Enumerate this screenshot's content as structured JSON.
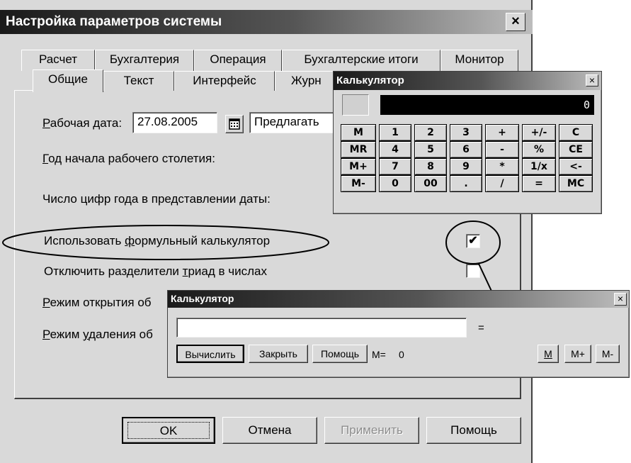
{
  "dialog": {
    "title": "Настройка параметров системы",
    "close": "×",
    "tabs_back": [
      "Расчет",
      "Бухгалтерия",
      "Операция",
      "Бухгалтерские итоги",
      "Монитор"
    ],
    "tabs_front": [
      "Общие",
      "Текст",
      "Интерфейс",
      "Журн"
    ],
    "work_date": {
      "label_u": "Р",
      "label_rest": "абочая дата:",
      "value": "27.08.2005",
      "combo_value": "Предлагать"
    },
    "century": {
      "label_u": "Г",
      "label_rest": "од начала рабочего столетия:"
    },
    "digits": {
      "label": "Число цифр года в представлении даты:"
    },
    "formula_calc": {
      "pre": "Использовать ",
      "u": "ф",
      "post": "ормульный калькулятор",
      "checked": "✔"
    },
    "triads": {
      "pre": "Отключить разделители ",
      "u": "т",
      "post": "риад в числах"
    },
    "open_mode": {
      "u": "Р",
      "rest": "ежим открытия об"
    },
    "delete_mode": {
      "u": "Р",
      "mid": "ежим ",
      "u2": "у",
      "rest": "даления об"
    },
    "buttons": {
      "ok": "OK",
      "cancel": "Отмена",
      "apply": "Применить",
      "help": "Помощь"
    }
  },
  "calculator": {
    "title": "Калькулятор",
    "close": "×",
    "display": "0",
    "keys": [
      [
        "M",
        "1",
        "2",
        "3",
        "+",
        "+/-",
        "C"
      ],
      [
        "MR",
        "4",
        "5",
        "6",
        "-",
        "%",
        "CE"
      ],
      [
        "M+",
        "7",
        "8",
        "9",
        "*",
        "1/x",
        "<-"
      ],
      [
        "M-",
        "0",
        "00",
        ".",
        "/",
        "=",
        "MC"
      ]
    ]
  },
  "formula_calculator": {
    "title": "Калькулятор",
    "close": "×",
    "input_value": "",
    "equals": "=",
    "buttons": {
      "compute": "Вычислить",
      "close": "Закрыть",
      "help": "Помощь"
    },
    "memory_label": "M=",
    "memory_value": "0",
    "mem_buttons": {
      "m": "M",
      "mplus": "M+",
      "mminus": "M-"
    }
  }
}
